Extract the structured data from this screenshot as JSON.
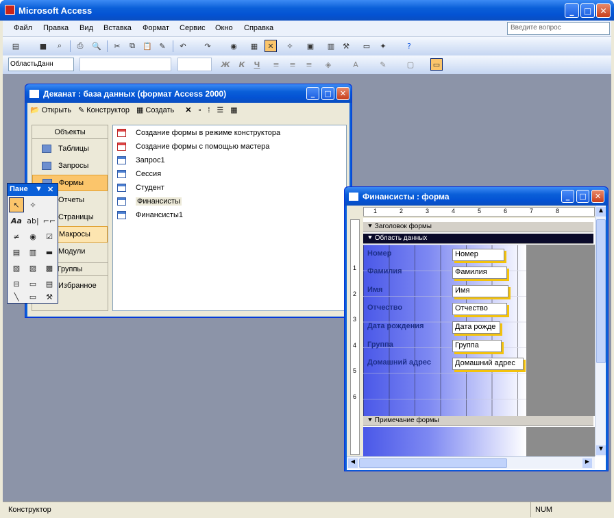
{
  "app": {
    "title": "Microsoft Access"
  },
  "menu": {
    "items": [
      "Файл",
      "Правка",
      "Вид",
      "Вставка",
      "Формат",
      "Сервис",
      "Окно",
      "Справка"
    ],
    "help_placeholder": "Введите вопрос"
  },
  "toolbar": {
    "object_combo": "ОбластьДанн",
    "bold": "Ж",
    "italic": "К",
    "underline": "Ч"
  },
  "db_window": {
    "title": "Деканат : база данных (формат Access 2000)",
    "toolbar": {
      "open": "Открыть",
      "design": "Конструктор",
      "create": "Создать"
    },
    "objects_header": "Объекты",
    "objects": [
      "Таблицы",
      "Запросы",
      "Формы",
      "Отчеты",
      "Страницы",
      "Макросы",
      "Модули"
    ],
    "groups_header": "Группы",
    "groups": [
      "Избранное"
    ],
    "list": [
      "Создание формы в режиме конструктора",
      "Создание формы с помощью мастера",
      "Запрос1",
      "Сессия",
      "Студент",
      "Финансисты",
      "Финансисты1"
    ]
  },
  "toolbox": {
    "title": "Пане"
  },
  "form_window": {
    "title": "Финансисты : форма",
    "sections": {
      "header": "Заголовок формы",
      "detail": "Область данных",
      "footer": "Примечание формы"
    },
    "ruler": [
      "1",
      "2",
      "3",
      "4",
      "5",
      "6",
      "7",
      "8"
    ],
    "vruler": [
      "1",
      "2",
      "3",
      "4",
      "5",
      "6"
    ],
    "fields": [
      {
        "label": "Номер",
        "value": "Номер"
      },
      {
        "label": "Фамилия",
        "value": "Фамилия"
      },
      {
        "label": "Имя",
        "value": "Имя"
      },
      {
        "label": "Отчество",
        "value": "Отчество"
      },
      {
        "label": "Дата рождения",
        "value": "Дата рожде"
      },
      {
        "label": "Группа",
        "value": "Группа"
      },
      {
        "label": "Домашний адрес",
        "value": "Домашний адрес"
      }
    ]
  },
  "status": {
    "left": "Конструктор",
    "num": "NUM"
  }
}
